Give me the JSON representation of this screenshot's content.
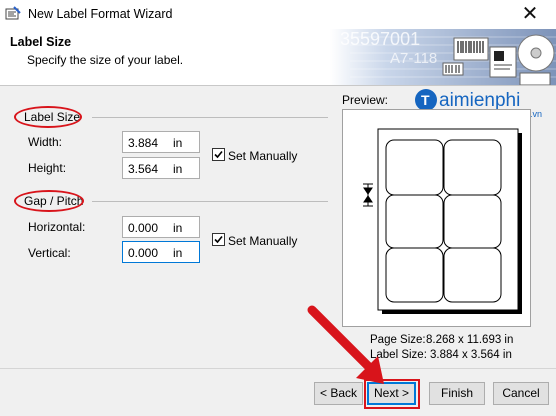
{
  "window": {
    "title": "New Label Format Wizard",
    "close_glyph": "✕"
  },
  "header": {
    "title": "Label Size",
    "subtitle": "Specify the size of your label.",
    "banner_text_1": "35597001",
    "banner_text_2": "A7-118"
  },
  "label_size": {
    "group_label": "Label Size",
    "width_label": "Width:",
    "width_value": "3.884",
    "width_unit": "in",
    "height_label": "Height:",
    "height_value": "3.564",
    "height_unit": "in",
    "set_manually_label": "Set Manually",
    "set_manually_checked": true
  },
  "gap_pitch": {
    "group_label": "Gap / Pitch",
    "horizontal_label": "Horizontal:",
    "horizontal_value": "0.000",
    "horizontal_unit": "in",
    "vertical_label": "Vertical:",
    "vertical_value": "0.000",
    "vertical_unit": "in",
    "set_manually_label": "Set Manually",
    "set_manually_checked": true
  },
  "preview": {
    "caption": "Preview:",
    "page_size_label": "Page Size:",
    "page_size_value": "8.268 x 11.693 in",
    "label_size_label": "Label Size:",
    "label_size_value": "3.884 x 3.564 in",
    "grid_columns": 2,
    "grid_rows": 3
  },
  "buttons": {
    "back": "< Back",
    "next": "Next >",
    "finish": "Finish",
    "cancel": "Cancel"
  },
  "watermark": {
    "brand": "aimienphi",
    "suffix": ".vn"
  },
  "colors": {
    "annotation_red": "#d8141b",
    "focus_blue": "#0078d7",
    "watermark_blue": "#1565c0"
  }
}
